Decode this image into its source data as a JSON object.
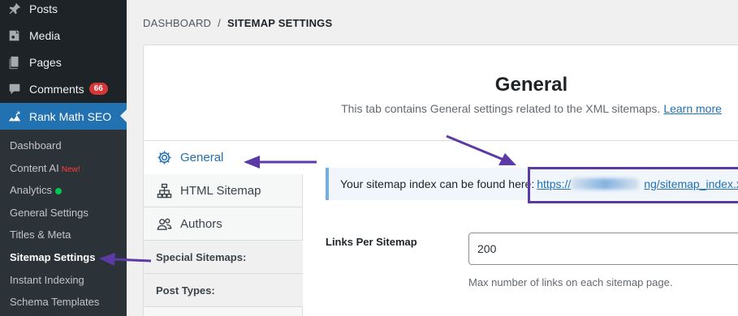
{
  "sidebar": {
    "menu": [
      {
        "label": "Posts",
        "icon": "pin-icon"
      },
      {
        "label": "Media",
        "icon": "media-icon"
      },
      {
        "label": "Pages",
        "icon": "pages-icon"
      },
      {
        "label": "Comments",
        "icon": "comment-icon",
        "badge": "66"
      },
      {
        "label": "Rank Math SEO",
        "icon": "rank-math-icon"
      }
    ],
    "submenu": [
      {
        "label": "Dashboard"
      },
      {
        "label": "Content AI",
        "tag": "New!"
      },
      {
        "label": "Analytics"
      },
      {
        "label": "General Settings"
      },
      {
        "label": "Titles & Meta"
      },
      {
        "label": "Sitemap Settings"
      },
      {
        "label": "Instant Indexing"
      },
      {
        "label": "Schema Templates"
      }
    ]
  },
  "breadcrumb": {
    "root": "DASHBOARD",
    "separator": "/",
    "current": "SITEMAP SETTINGS"
  },
  "panel": {
    "title": "General",
    "description": "This tab contains General settings related to the XML sitemaps.",
    "learn_more": "Learn more"
  },
  "tabs": {
    "items": [
      {
        "label": "General",
        "icon": "gear-icon"
      },
      {
        "label": "HTML Sitemap",
        "icon": "sitemap-icon"
      },
      {
        "label": "Authors",
        "icon": "users-icon"
      }
    ],
    "special_heading": "Special Sitemaps:",
    "post_types_heading": "Post Types:"
  },
  "notice": {
    "text": "Your sitemap index can be found here:",
    "link_prefix": "https://",
    "link_visible": "ng/sitemap_index.xml"
  },
  "fields": {
    "links_per_sitemap": {
      "label": "Links Per Sitemap",
      "value": "200",
      "help": "Max number of links on each sitemap page."
    }
  },
  "colors": {
    "sidebar_bg": "#1d2327",
    "active_bg": "#2271b1",
    "badge": "#d63638",
    "annotation": "#5b3aa6"
  }
}
